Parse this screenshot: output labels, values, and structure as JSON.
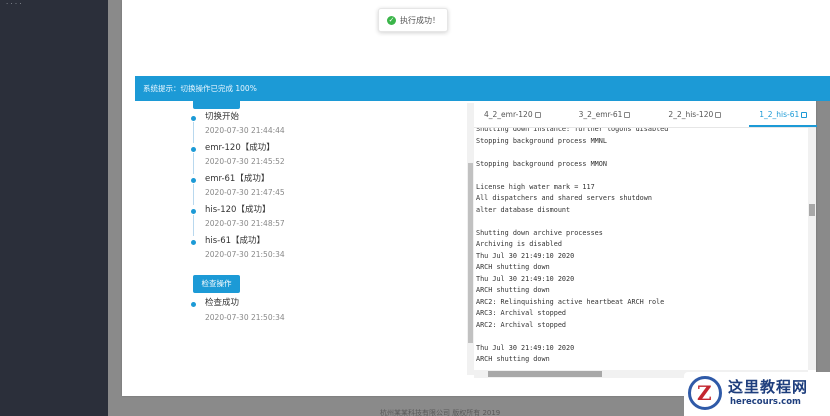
{
  "sidebar": {
    "mini_text": "· · · ·"
  },
  "toast": {
    "message": "执行成功！",
    "icon": "check-circle-icon"
  },
  "banner": {
    "text": "系统提示：切换操作已完成 100%"
  },
  "switch_timeline": [
    {
      "title": "切换开始",
      "time": "2020-07-30 21:44:44"
    },
    {
      "title": "emr-120【成功】",
      "time": "2020-07-30 21:45:52"
    },
    {
      "title": "emr-61【成功】",
      "time": "2020-07-30 21:47:45"
    },
    {
      "title": "his-120【成功】",
      "time": "2020-07-30 21:48:57"
    },
    {
      "title": "his-61【成功】",
      "time": "2020-07-30 21:50:34"
    }
  ],
  "check": {
    "button_label": "检查操作",
    "item_title": "检查成功",
    "item_time": "2020-07-30 21:50:34"
  },
  "tabs": [
    {
      "label": "4_2_emr-120",
      "active": false
    },
    {
      "label": "3_2_emr-61",
      "active": false
    },
    {
      "label": "2_2_his-120",
      "active": false
    },
    {
      "label": "1_2_his-61",
      "active": true
    }
  ],
  "log_text": "Shutting down instance: further logons disabled\nStopping background process MMNL\n\nStopping background process MMON\n\nLicense high water mark = 117\nAll dispatchers and shared servers shutdown\nalter database dismount\n\nShutting down archive processes\nArchiving is disabled\nThu Jul 30 21:49:10 2020\nARCH shutting down\nThu Jul 30 21:49:10 2020\nARCH shutting down\nARC2: Relinquishing active heartbeat ARCH role\nARC3: Archival stopped\nARC2: Archival stopped\n\nThu Jul 30 21:49:10 2020\nARCH shutting down",
  "footer": {
    "text": "杭州某某科技有限公司 版权所有 2019"
  },
  "watermark": {
    "cn": "这里教程网",
    "en": "herecours.com"
  },
  "colors": {
    "accent": "#1c9ad6",
    "sidebar": "#2b2f3a",
    "success": "#3bb54a"
  }
}
